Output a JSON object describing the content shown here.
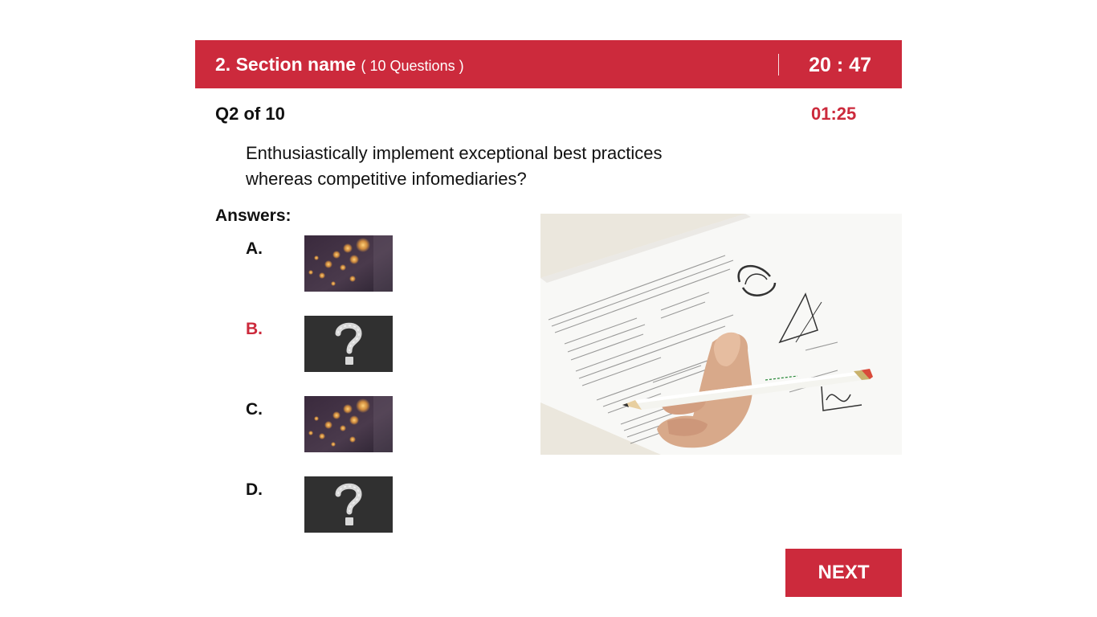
{
  "theme": {
    "accent": "#cc2a3c"
  },
  "header": {
    "section_title": "2. Section name",
    "question_count": "( 10 Questions )",
    "timer": "20 : 47"
  },
  "question": {
    "number": "Q2 of 10",
    "timer": "01:25",
    "text": "Enthusiastically implement exceptional best practices whereas competitive infomediaries?"
  },
  "answers": {
    "label": "Answers:",
    "options": [
      {
        "letter": "A.",
        "image": "bokeh-lights-image",
        "selected": false
      },
      {
        "letter": "B.",
        "image": "question-mark-chalkboard-image",
        "selected": true
      },
      {
        "letter": "C.",
        "image": "bokeh-lights-image",
        "selected": false
      },
      {
        "letter": "D.",
        "image": "question-mark-chalkboard-image",
        "selected": false
      }
    ]
  },
  "illustration": {
    "image": "exam-paper-pencil-photo"
  },
  "footer": {
    "next_label": "NEXT"
  }
}
